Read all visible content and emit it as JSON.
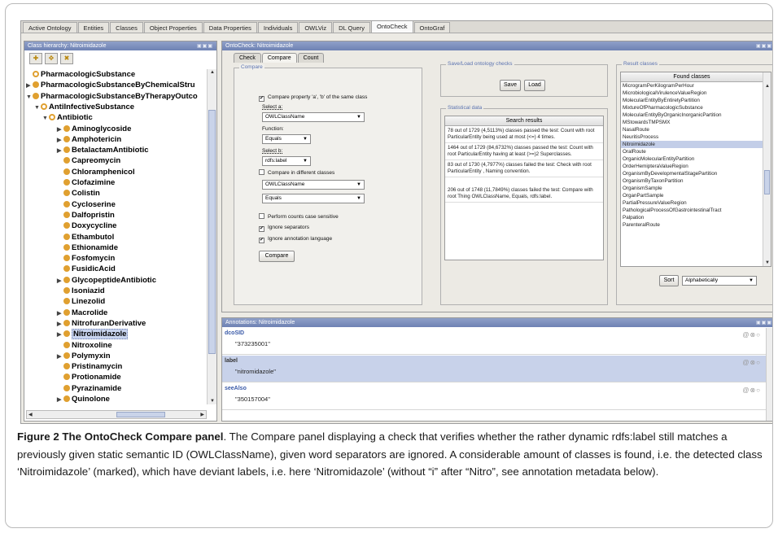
{
  "tabs": [
    "Active Ontology",
    "Entities",
    "Classes",
    "Object Properties",
    "Data Properties",
    "Individuals",
    "OWLViz",
    "DL Query",
    "OntoCheck",
    "OntoGraf"
  ],
  "active_tab": "OntoCheck",
  "class_hierarchy": {
    "title": "Class hierarchy: Nitroimidazole",
    "tree": [
      {
        "label": "PharmacologicSubstance",
        "indent": 0,
        "toggle": "",
        "open": true
      },
      {
        "label": "PharmacologicSubstanceByChemicalStru",
        "indent": 0,
        "toggle": "▶",
        "open": false
      },
      {
        "label": "PharmacologicSubstanceByTherapyOutco",
        "indent": 0,
        "toggle": "▼",
        "open": false
      },
      {
        "label": "AntiInfectiveSubstance",
        "indent": 1,
        "toggle": "▼",
        "open": true
      },
      {
        "label": "Antibiotic",
        "indent": 2,
        "toggle": "▼",
        "open": true
      },
      {
        "label": "Aminoglycoside",
        "indent": 3,
        "toggle": "▶",
        "open": false
      },
      {
        "label": "Amphotericin",
        "indent": 3,
        "toggle": "▶",
        "open": false
      },
      {
        "label": "BetalactamAntibiotic",
        "indent": 3,
        "toggle": "▶",
        "open": false
      },
      {
        "label": "Capreomycin",
        "indent": 3,
        "toggle": "",
        "open": false
      },
      {
        "label": "Chloramphenicol",
        "indent": 3,
        "toggle": "",
        "open": false
      },
      {
        "label": "Clofazimine",
        "indent": 3,
        "toggle": "",
        "open": false
      },
      {
        "label": "Colistin",
        "indent": 3,
        "toggle": "",
        "open": false
      },
      {
        "label": "Cycloserine",
        "indent": 3,
        "toggle": "",
        "open": false
      },
      {
        "label": "Dalfopristin",
        "indent": 3,
        "toggle": "",
        "open": false
      },
      {
        "label": "Doxycycline",
        "indent": 3,
        "toggle": "",
        "open": false
      },
      {
        "label": "Ethambutol",
        "indent": 3,
        "toggle": "",
        "open": false
      },
      {
        "label": "Ethionamide",
        "indent": 3,
        "toggle": "",
        "open": false
      },
      {
        "label": "Fosfomycin",
        "indent": 3,
        "toggle": "",
        "open": false
      },
      {
        "label": "FusidicAcid",
        "indent": 3,
        "toggle": "",
        "open": false
      },
      {
        "label": "GlycopeptideAntibiotic",
        "indent": 3,
        "toggle": "▶",
        "open": false
      },
      {
        "label": "Isoniazid",
        "indent": 3,
        "toggle": "",
        "open": false
      },
      {
        "label": "Linezolid",
        "indent": 3,
        "toggle": "",
        "open": false
      },
      {
        "label": "Macrolide",
        "indent": 3,
        "toggle": "▶",
        "open": false
      },
      {
        "label": "NitrofuranDerivative",
        "indent": 3,
        "toggle": "▶",
        "open": false
      },
      {
        "label": "Nitroimidazole",
        "indent": 3,
        "toggle": "▶",
        "open": false,
        "selected": true
      },
      {
        "label": "Nitroxoline",
        "indent": 3,
        "toggle": "",
        "open": false
      },
      {
        "label": "Polymyxin",
        "indent": 3,
        "toggle": "▶",
        "open": false
      },
      {
        "label": "Pristinamycin",
        "indent": 3,
        "toggle": "",
        "open": false
      },
      {
        "label": "Protionamide",
        "indent": 3,
        "toggle": "",
        "open": false
      },
      {
        "label": "Pyrazinamide",
        "indent": 3,
        "toggle": "",
        "open": false
      },
      {
        "label": "Quinolone",
        "indent": 3,
        "toggle": "▶",
        "open": false
      }
    ]
  },
  "ontocheck": {
    "title": "OntoCheck: Nitroimidazole",
    "subtabs": [
      "Check",
      "Compare",
      "Count"
    ],
    "active_subtab": "Compare",
    "compare": {
      "group_title": "Compare",
      "same_class_label": "Compare property 'a', 'b' of the same class",
      "same_class_checked": true,
      "select_a_label": "Select a:",
      "select_a_value": "OWLClassName",
      "function_label": "Function:",
      "function_value": "Equals",
      "select_b_label": "Select b:",
      "select_b_value": "rdfs:label",
      "diff_classes_label": "Compare in different classes",
      "diff_classes_checked": false,
      "diff_select_1": "OWLClassName",
      "diff_select_2": "Equals",
      "case_sensitive_label": "Perform counts case sensitive",
      "case_sensitive_checked": false,
      "ignore_separators_label": "Ignore separators",
      "ignore_separators_checked": true,
      "ignore_annotation_label": "Ignore annotation language",
      "ignore_annotation_checked": true,
      "compare_button": "Compare"
    },
    "save_load": {
      "title": "Save/Load ontology checks",
      "save_button": "Save",
      "load_button": "Load"
    },
    "statistical": {
      "title": "Statistical data",
      "header": "Search results",
      "results": [
        "78 out of 1729 (4,5113%) classes passed the test: Count with root ParticularEntity being used at most (<=) 4 times.",
        "1464 out of 1729 (84,6732%) classes passed the test: Count with root ParticularEntity having at least (>=)2 Superclasses.",
        "83 out of 1730 (4,7977%) classes failed the test: Check with root ParticularEntity , Naming convention.",
        "206 out of 1748 (11,7849%) classes failed the test: Compare with root Thing OWLClassName, Equals, rdfs:label."
      ]
    },
    "result_classes": {
      "title": "Result classes",
      "header": "Found classes",
      "items": [
        "MicrogramPerKilogramPerHour",
        "MicrobiologicalVirulenceValueRegion",
        "MolecularEntityByEntiretyPartition",
        "MixtureOfPharmacologicSubstance",
        "MolecularEntityByOrganicInorganicPartition",
        "MStowardsTMPSMX",
        "NasalRoute",
        "NeuritisProcess",
        "Nitroimidazole",
        "OralRoute",
        "OrganicMolecularEntityPartition",
        "OrderHemipteraValueRegion",
        "OrganismByDevelopmentalStagePartition",
        "OrganismByTaxonPartition",
        "OrganismSample",
        "OrganPartSample",
        "PartialPressureValueRegion",
        "PathologicalProcessOfGastrointestinalTract",
        "Palpation",
        "ParenteralRoute"
      ],
      "selected": "Nitroimidazole",
      "sort_button": "Sort",
      "sort_value": "Alphabetically"
    }
  },
  "annotations": {
    "title": "Annotations: Nitroimidazole",
    "rows": [
      {
        "property": "dcoSID",
        "value": "\"373235001\"",
        "selected": false
      },
      {
        "property": "label",
        "value": "\"nitromidazole\"",
        "selected": true
      },
      {
        "property": "seeAlso",
        "value": "\"350157004\"",
        "selected": false
      }
    ]
  },
  "caption": {
    "label": "Figure 2 The OntoCheck Compare panel",
    "text": ". The Compare panel displaying a check that verifies whether the rather dynamic rdfs:label still matches a previously given static semantic ID (OWLClassName), given word separators are ignored. A considerable amount of classes is found, i.e. the detected class ‘Nitroimidazole’ (marked), which have deviant labels, i.e. here ‘Nitromidazole’ (without “i” after “Nitro”, see annotation metadata below)."
  }
}
